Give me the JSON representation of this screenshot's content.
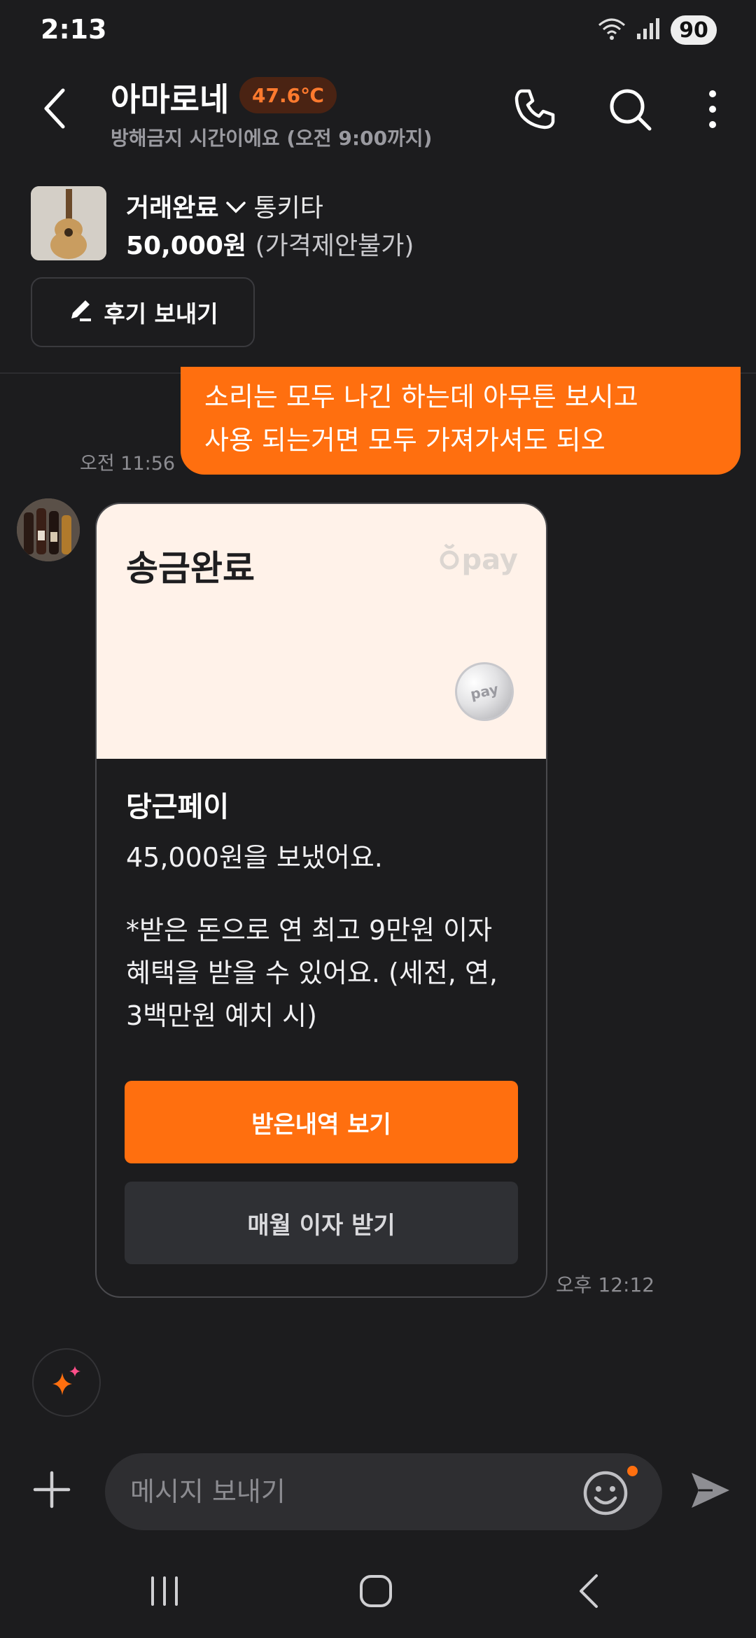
{
  "status_bar": {
    "time": "2:13",
    "battery": "90",
    "icons": [
      "wifi-icon",
      "signal-icon"
    ]
  },
  "header": {
    "title": "아마로네",
    "temperature": "47.6℃",
    "subtitle": "방해금지 시간이에요 (오전 9:00까지)",
    "icons": [
      "back-icon",
      "phone-icon",
      "search-icon",
      "more-icon"
    ]
  },
  "product": {
    "status": "거래완료",
    "name": "통키타",
    "price": "50,000원",
    "price_note": "(가격제안불가)",
    "review_button": "후기 보내기"
  },
  "messages": {
    "outgoing": {
      "line1": "소리는 모두 나긴 하는데 아무튼 보시고",
      "line2": "사용 되는거면 모두 가져가셔도 되오",
      "time": "오전 11:56"
    },
    "card": {
      "title": "송금완료",
      "brand": "pay",
      "coin_label": "pay",
      "subtitle": "당근페이",
      "amount_text": "45,000원을 보냈어요.",
      "note_line1": "*받은 돈으로 연 최고 9만원 이자",
      "note_line2": "혜택을 받을 수 있어요. (세전, 연,",
      "note_line3": "3백만원 예치 시)",
      "primary_button": "받은내역 보기",
      "secondary_button": "매월 이자 받기",
      "time": "오후 12:12"
    }
  },
  "composer": {
    "placeholder": "메시지 보내기"
  },
  "colors": {
    "accent": "#ff6f0f",
    "background": "#1c1c1e",
    "card_top": "#fff2e9"
  }
}
